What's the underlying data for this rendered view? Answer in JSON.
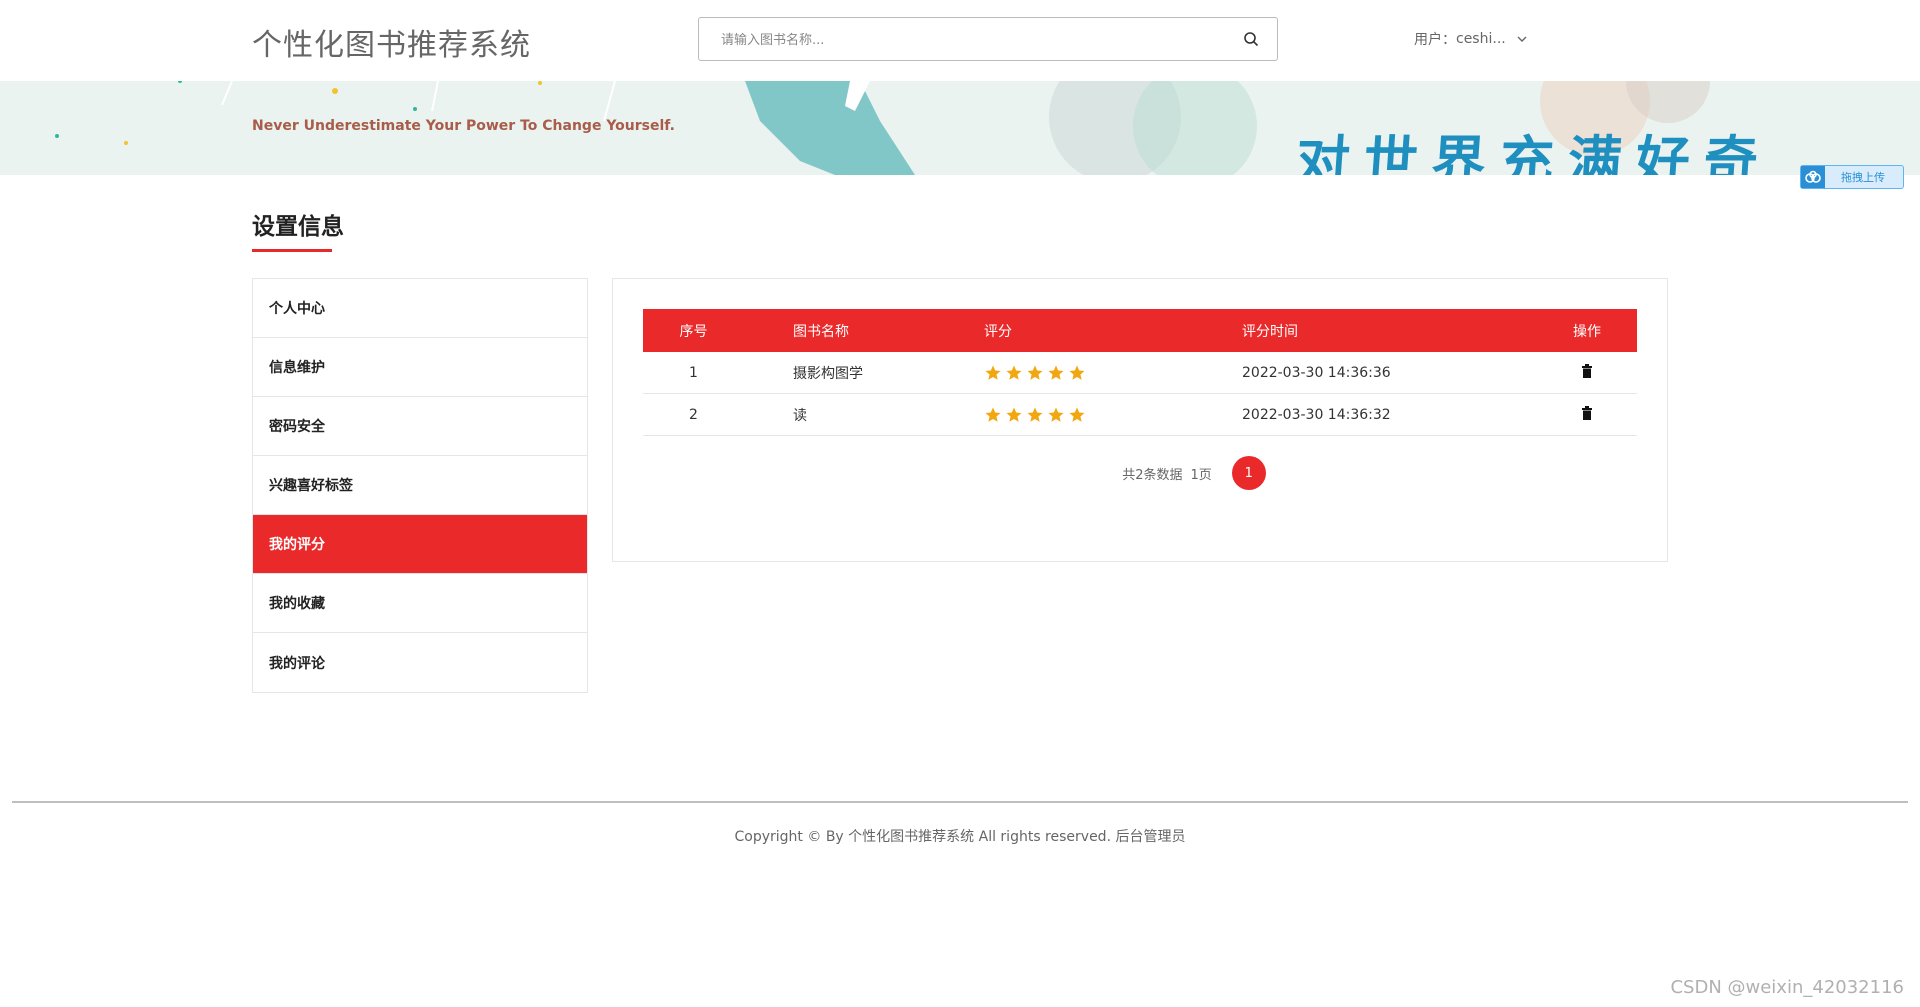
{
  "header": {
    "site_title": "个性化图书推荐系统",
    "search_placeholder": "请输入图书名称...",
    "search_icon": "search-icon",
    "user_label": "用户：",
    "user_name": "ceshi..."
  },
  "banner": {
    "slogan": "Never Underestimate Your Power To Change Yourself.",
    "cn_text": "对世界充满好奇",
    "upload_label": "拖拽上传"
  },
  "section": {
    "title": "设置信息"
  },
  "sidebar": {
    "items": [
      {
        "label": "个人中心",
        "active": false
      },
      {
        "label": "信息维护",
        "active": false
      },
      {
        "label": "密码安全",
        "active": false
      },
      {
        "label": "兴趣喜好标签",
        "active": false
      },
      {
        "label": "我的评分",
        "active": true
      },
      {
        "label": "我的收藏",
        "active": false
      },
      {
        "label": "我的评论",
        "active": false
      }
    ]
  },
  "table": {
    "headers": [
      "序号",
      "图书名称",
      "评分",
      "评分时间",
      "操作"
    ],
    "rows": [
      {
        "index": "1",
        "name": "摄影构图学",
        "rating": 5,
        "time": "2022-03-30 14:36:36"
      },
      {
        "index": "2",
        "name": "读",
        "rating": 5,
        "time": "2022-03-30 14:36:32"
      }
    ]
  },
  "pagination": {
    "info": "共2条数据",
    "pages": "1页",
    "current": "1"
  },
  "footer": {
    "copyright": "Copyright © By 个性化图书推荐系统 All rights reserved.",
    "admin_link": "后台管理员",
    "watermark": "CSDN @weixin_42032116"
  },
  "colors": {
    "accent": "#ea2a2a",
    "star": "#f2a60f",
    "banner_bg": "#eaf3ef",
    "banner_text": "#1f8fc0"
  }
}
